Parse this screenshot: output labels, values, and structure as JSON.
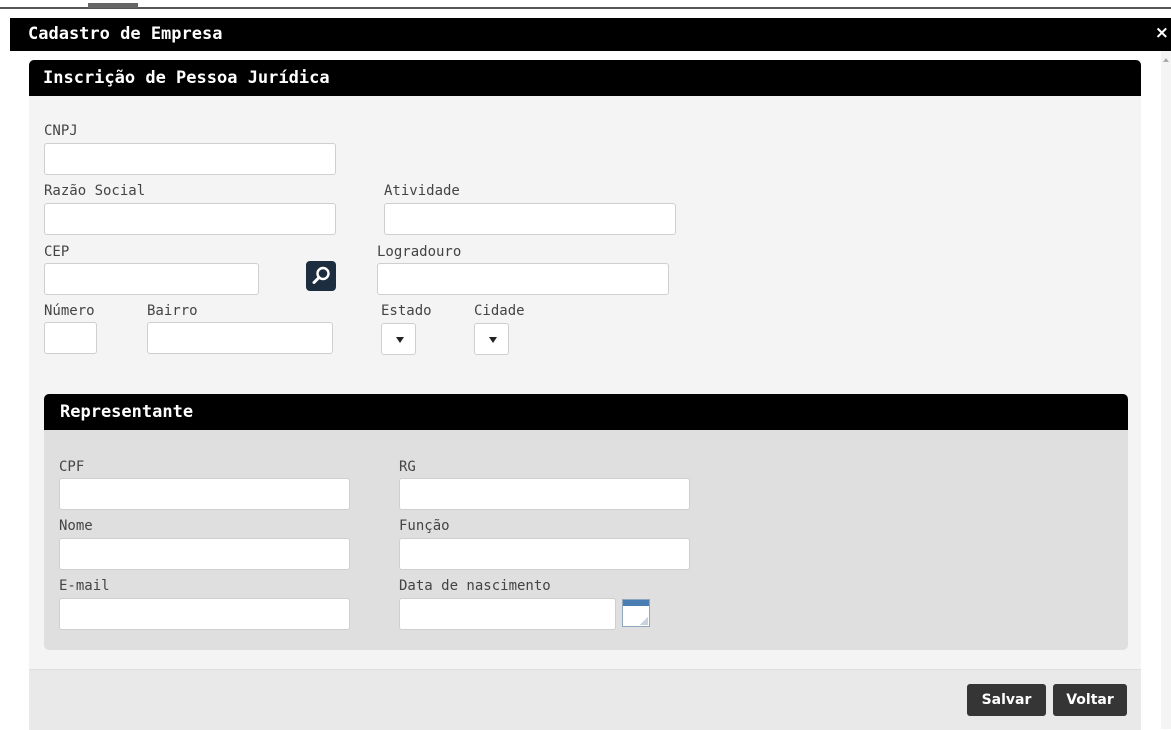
{
  "modal": {
    "title": "Cadastro de Empresa",
    "close_symbol": "×"
  },
  "company_panel": {
    "title": "Inscrição de Pessoa Jurídica",
    "fields": {
      "cnpj": {
        "label": "CNPJ",
        "value": ""
      },
      "razao_social": {
        "label": "Razão Social",
        "value": ""
      },
      "atividade": {
        "label": "Atividade",
        "value": ""
      },
      "cep": {
        "label": "CEP",
        "value": ""
      },
      "logradouro": {
        "label": "Logradouro",
        "value": ""
      },
      "numero": {
        "label": "Número",
        "value": ""
      },
      "bairro": {
        "label": "Bairro",
        "value": ""
      },
      "estado": {
        "label": "Estado",
        "selected": ""
      },
      "cidade": {
        "label": "Cidade",
        "selected": ""
      }
    },
    "icons": {
      "cep_search": "search-icon"
    }
  },
  "representative_panel": {
    "title": "Representante",
    "fields": {
      "cpf": {
        "label": "CPF",
        "value": ""
      },
      "rg": {
        "label": "RG",
        "value": ""
      },
      "nome": {
        "label": "Nome",
        "value": ""
      },
      "funcao": {
        "label": "Função",
        "value": ""
      },
      "email": {
        "label": "E-mail",
        "value": ""
      },
      "data_nascimento": {
        "label": "Data de nascimento",
        "value": ""
      }
    },
    "icons": {
      "date_picker": "calendar-icon"
    }
  },
  "footer": {
    "save_label": "Salvar",
    "back_label": "Voltar"
  },
  "colors": {
    "header_bg": "#000000",
    "panel_bg": "#f4f4f4",
    "representative_bg": "#dfdfdf",
    "search_button_bg": "#1b2d3e",
    "action_button_bg": "#353535"
  }
}
